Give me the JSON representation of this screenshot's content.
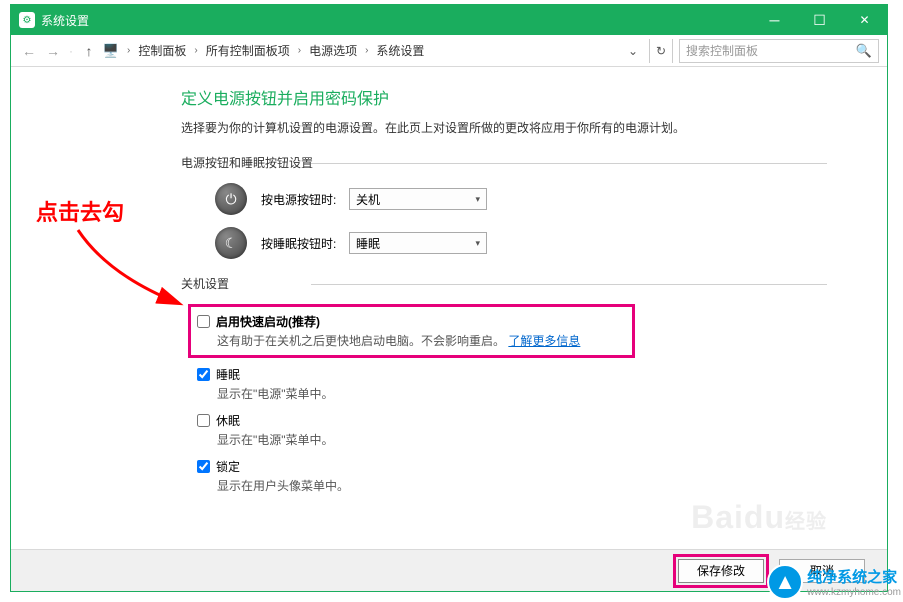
{
  "window": {
    "title": "系统设置"
  },
  "nav": {
    "crumb1": "控制面板",
    "crumb2": "所有控制面板项",
    "crumb3": "电源选项",
    "crumb4": "系统设置",
    "search_placeholder": "搜索控制面板"
  },
  "page": {
    "heading": "定义电源按钮并启用密码保护",
    "subtitle": "选择要为你的计算机设置的电源设置。在此页上对设置所做的更改将应用于你所有的电源计划。"
  },
  "button_settings": {
    "legend": "电源按钮和睡眠按钮设置",
    "power_label": "按电源按钮时:",
    "power_value": "关机",
    "sleep_label": "按睡眠按钮时:",
    "sleep_value": "睡眠"
  },
  "shutdown_settings": {
    "legend": "关机设置",
    "fast_startup": {
      "label": "启用快速启动(推荐)",
      "desc1": "这有助于在关机之后更快地启动电脑。不会影响重启。",
      "link": "了解更多信息",
      "checked": false
    },
    "sleep": {
      "label": "睡眠",
      "desc": "显示在\"电源\"菜单中。",
      "checked": true
    },
    "hibernate": {
      "label": "休眠",
      "desc": "显示在\"电源\"菜单中。",
      "checked": false
    },
    "lock": {
      "label": "锁定",
      "desc": "显示在用户头像菜单中。",
      "checked": true
    }
  },
  "footer": {
    "save": "保存修改",
    "cancel": "取消"
  },
  "annotation": {
    "text": "点击去勾"
  },
  "watermark": {
    "brand": "纯净系统之家",
    "url": "www.kzmyhome.com"
  }
}
